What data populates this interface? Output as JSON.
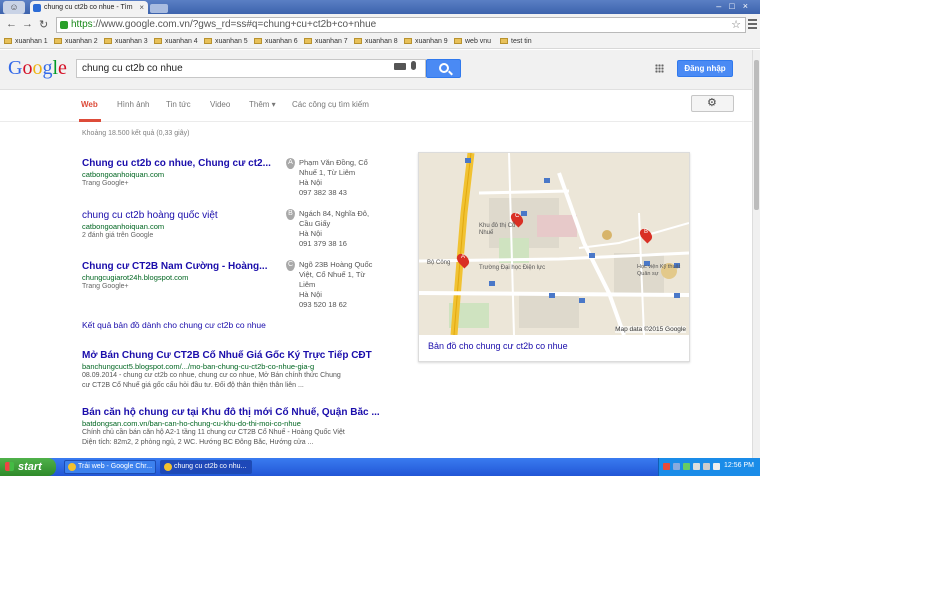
{
  "browser": {
    "tab_title": "chung cu ct2b co nhue - Tìm",
    "url_scheme": "https",
    "url_rest": "://www.google.com.vn/?gws_rd=ss#q=chung+cu+ct2b+co+nhue",
    "bookmarks": [
      "xuanhan 1",
      "xuanhan 2",
      "xuanhan 3",
      "xuanhan 4",
      "xuanhan 5",
      "xuanhan 6",
      "xuanhan 7",
      "xuanhan 8",
      "xuanhan 9",
      "web vnu",
      "test tin"
    ]
  },
  "google": {
    "logo": [
      {
        "ch": "G",
        "color": "#3369e8"
      },
      {
        "ch": "o",
        "color": "#d50f25"
      },
      {
        "ch": "o",
        "color": "#eeb211"
      },
      {
        "ch": "g",
        "color": "#3369e8"
      },
      {
        "ch": "l",
        "color": "#009925"
      },
      {
        "ch": "e",
        "color": "#d50f25"
      }
    ],
    "query": "chung cu ct2b co nhue",
    "signin_label": "Đăng nhập",
    "tabs": [
      "Web",
      "Hình ảnh",
      "Tin tức",
      "Video",
      "Thêm ▾",
      "Các công cụ tìm kiếm"
    ],
    "active_tab": "Web",
    "stats": "Khoảng 18.500 kết quả (0,33 giây)"
  },
  "local_results": [
    {
      "title": "Chung cu ct2b co nhue, Chung cư ct2...",
      "url": "catbongoanhoiquan.com",
      "source": "Trang Google+",
      "pin": "A",
      "address": [
        "Phạm Văn Đồng, Cổ",
        "Nhuế 1, Từ Liêm",
        "Hà Nội",
        "097 382 38 43"
      ]
    },
    {
      "title": "chung cu ct2b hoàng quốc việt",
      "url": "catbongoanhoiquan.com",
      "source": "2 đánh giá trên Google",
      "pin": "B",
      "address": [
        "Ngách 84, Nghĩa Đô,",
        "Cầu Giấy",
        "Hà Nội",
        "091 379 38 16"
      ]
    },
    {
      "title": "Chung cư CT2B Nam Cường - Hoàng...",
      "url": "chungcugiarot24h.blogspot.com",
      "source": "Trang Google+",
      "pin": "C",
      "address": [
        "Ngõ 23B Hoàng Quốc",
        "Việt, Cổ Nhuế 1, Từ",
        "Liêm",
        "Hà Nội",
        "093 520 18 62"
      ]
    }
  ],
  "more_map_results": "Kết quả bản đồ dành cho chung cư ct2b co nhue",
  "web_results": [
    {
      "title": "Mở Bán Chung Cư CT2B Cổ Nhuế Giá Gốc Ký Trực Tiếp CĐT",
      "url": "banchungcuct5.blogspot.com/.../mo-ban-chung-cu-ct2b-co-nhue-gia-g",
      "snippet": [
        "08.09.2014 - chung cư ct2b co nhue, chung cư co nhue, Mở Bán chính thức Chung",
        "cư CT2B Cổ Nhuế giá gốc cấu hỏi đầu tư. Đối độ thân thiện thân liên ..."
      ]
    },
    {
      "title": "Bán căn hộ chung cư tại Khu đô thị mới Cổ Nhuế, Quận Bắc ...",
      "url": "batdongsan.com.vn/ban-can-ho-chung-cu-khu-do-thi-moi-co-nhue",
      "snippet": [
        "Chính chủ cần bán căn hộ A2-1 tầng 11 chung cư CT2B Cổ Nhuế - Hoàng Quốc Việt",
        "Diện tích: 82m2, 2 phòng ngủ, 2 WC. Hướng BC Đông Bắc, Hướng cửa ..."
      ]
    }
  ],
  "map": {
    "caption": "Bản đồ cho chung cư ct2b co nhue",
    "credit": "Map data ©2015 Google",
    "labels": [
      "Khu đô thị Cổ Nhuế",
      "Trường Đại học Điện lực",
      "Học viện Kỹ thuật Quân sự",
      "Bộ Công"
    ],
    "pins": [
      "A",
      "B",
      "C"
    ]
  },
  "taskbar": {
    "start_label": "start",
    "buttons": [
      "Trái web - Google Chr...",
      "chung cu ct2b co nhu..."
    ],
    "clock": "12:56 PM"
  }
}
